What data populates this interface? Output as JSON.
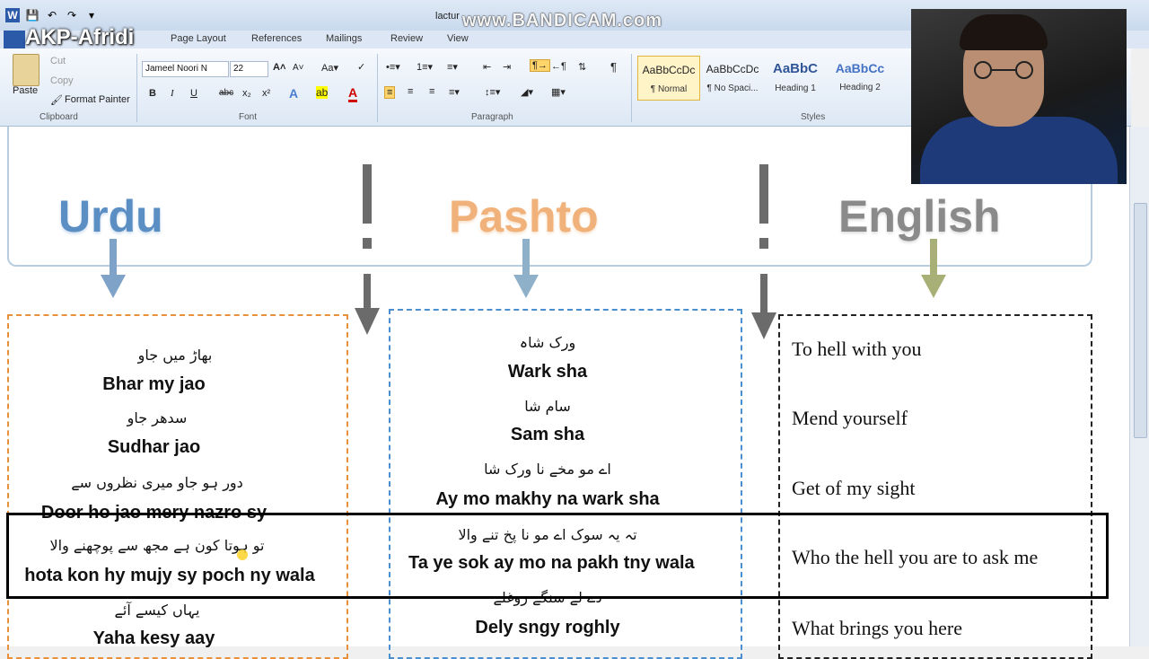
{
  "window": {
    "title": "lactur",
    "watermark": "www.BANDICAM.com",
    "overlay_label": "AKP-Afridi"
  },
  "tabs": [
    "Page Layout",
    "References",
    "Mailings",
    "Review",
    "View"
  ],
  "ribbon": {
    "clipboard": {
      "paste": "Paste",
      "cut": "Cut",
      "copy": "Copy",
      "format_painter": "Format Painter",
      "label": "Clipboard"
    },
    "font": {
      "family": "Jameel Noori N",
      "size": "22",
      "label": "Font",
      "bold": "B",
      "italic": "I",
      "underline": "U",
      "strike": "abc",
      "sub": "x₂",
      "sup": "x²"
    },
    "paragraph": {
      "label": "Paragraph"
    },
    "styles": {
      "label": "Styles",
      "items": [
        {
          "sample": "AaBbCcDc",
          "name": "¶ Normal"
        },
        {
          "sample": "AaBbCcDc",
          "name": "¶ No Spaci..."
        },
        {
          "sample": "AaBbC",
          "name": "Heading 1"
        },
        {
          "sample": "AaBbCc",
          "name": "Heading 2"
        }
      ]
    }
  },
  "columns": {
    "urdu_title": "Urdu",
    "pashto_title": "Pashto",
    "english_title": "English"
  },
  "colors": {
    "urdu": "#5b8fc4",
    "pashto": "#f0b27a",
    "english": "#8a8a8a",
    "urdu_box": "#e8913a",
    "pashto_box": "#4a8fd0",
    "english_box": "#222222"
  },
  "urdu_rows": [
    {
      "script": "بھاڑ میں جاو",
      "roman": "Bhar my jao"
    },
    {
      "script": "سدھر جاو",
      "roman": "Sudhar jao"
    },
    {
      "script": "دور ہو جاو میری نظروں سے",
      "roman": "Door ho jao mery nazro sy"
    },
    {
      "script": "تو ہوتا کون ہے مجھ سے پوچھنے والا",
      "roman": "hota kon hy mujy sy poch ny wala"
    },
    {
      "script": "یہاں کیسے آئے",
      "roman": "Yaha kesy aay"
    }
  ],
  "pashto_rows": [
    {
      "script": "ورک شاہ",
      "roman": "Wark sha"
    },
    {
      "script": "سام شا",
      "roman": "Sam sha"
    },
    {
      "script": "اے مو مخے نا ورک شا",
      "roman": "Ay mo makhy na wark sha"
    },
    {
      "script": "تہ یہ سوک اے مو نا پخ تنے والا",
      "roman": "Ta ye sok ay mo na pakh tny wala"
    },
    {
      "script": "دے لے سنگے روغلے",
      "roman": "Dely sngy roghly"
    }
  ],
  "english_rows": [
    "To hell with you",
    "Mend yourself",
    "Get of my sight",
    "Who the hell you are to ask me",
    "What brings you here"
  ]
}
